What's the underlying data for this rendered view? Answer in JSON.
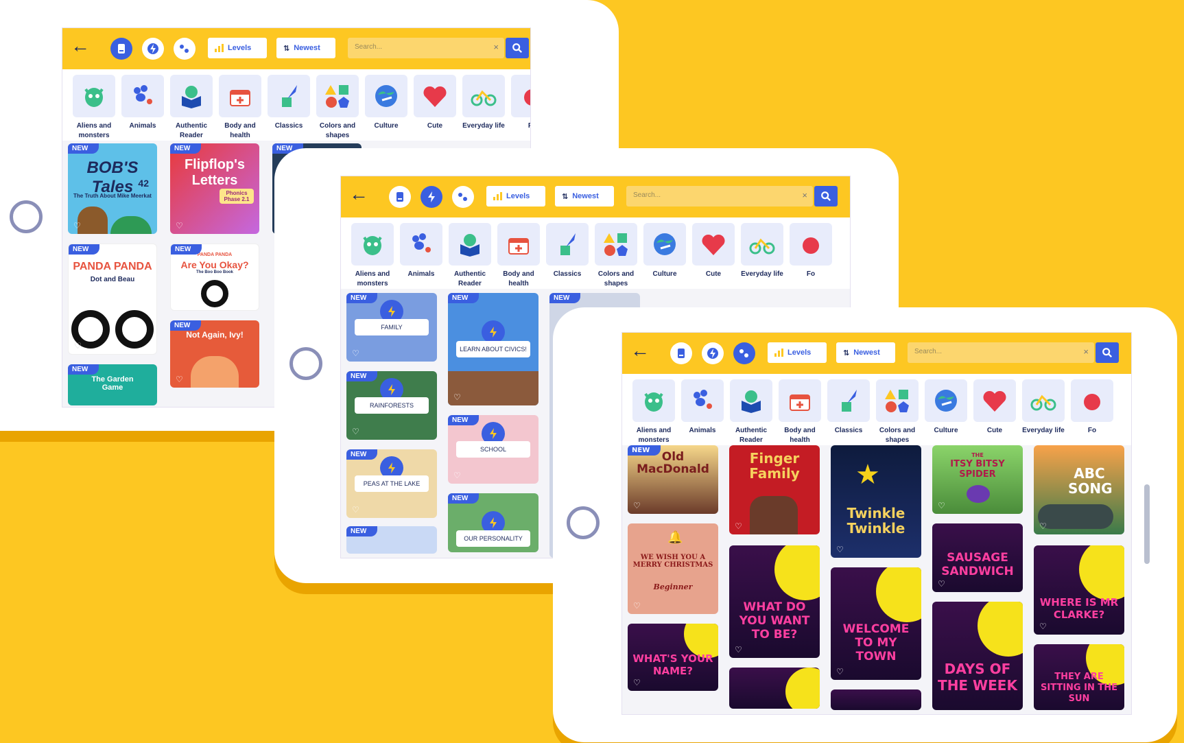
{
  "toolbar": {
    "levels_label": "Levels",
    "sort_label": "Newest",
    "search_placeholder": "Search...",
    "search_clear": "×"
  },
  "categories": [
    {
      "label": "Aliens and monsters",
      "icon": "alien-icon"
    },
    {
      "label": "Animals",
      "icon": "paw-icon"
    },
    {
      "label": "Authentic Reader",
      "icon": "book-icon"
    },
    {
      "label": "Body and health",
      "icon": "first-aid-icon"
    },
    {
      "label": "Classics",
      "icon": "quill-icon"
    },
    {
      "label": "Colors and shapes",
      "icon": "shapes-icon"
    },
    {
      "label": "Culture",
      "icon": "globe-icon"
    },
    {
      "label": "Cute",
      "icon": "heart-icon"
    },
    {
      "label": "Everyday life",
      "icon": "bicycle-icon"
    },
    {
      "label": "Fo",
      "icon": "food-icon"
    }
  ],
  "badge_new": "NEW",
  "screen1": {
    "books": [
      {
        "title": "BOB'S Tales",
        "sub": "The Truth About Mike Meerkat",
        "num": "42",
        "bg": "#5EC0E8"
      },
      {
        "title": "Flipflop's Letters",
        "sub": "Phonics Phase 2.1",
        "bg": "#E83A3A"
      },
      {
        "title": "PANDA PANDA",
        "sub": "Dot and Beau",
        "bg": "#ffffff"
      },
      {
        "title": "Are You Okay?",
        "sub": "The Boo Boo Book",
        "top": "PANDA PANDA",
        "bg": "#ffffff"
      },
      {
        "title": "Not Again, Ivy!",
        "bg": "#E65B3A"
      },
      {
        "title": "The Garden Game",
        "bg": "#1FAE9C"
      }
    ]
  },
  "screen2": {
    "topics": [
      {
        "label": "FAMILY"
      },
      {
        "label": "LEARN ABOUT CIVICS!"
      },
      {
        "label": "RAINFORESTS"
      },
      {
        "label": "SCHOOL"
      },
      {
        "label": "PEAS AT THE LAKE"
      },
      {
        "label": "OUR PERSONALITY"
      }
    ]
  },
  "screen3": {
    "songs": [
      {
        "title": "Old MacDonald"
      },
      {
        "title": "Finger Family"
      },
      {
        "title": "Twinkle Twinkle"
      },
      {
        "title": "ITSY BITSY SPIDER",
        "top": "THE"
      },
      {
        "title": "ABC SONG"
      },
      {
        "title": "WE WISH YOU A MERRY CHRISTMAS",
        "sub": "Beginner"
      },
      {
        "title": "WHAT DO YOU WANT TO BE?"
      },
      {
        "title": "WELCOME TO MY TOWN"
      },
      {
        "title": "SAUSAGE SANDWICH"
      },
      {
        "title": "WHERE IS MR CLARKE?"
      },
      {
        "title": "WHAT'S YOUR NAME?"
      },
      {
        "title": "DAYS OF THE WEEK"
      },
      {
        "title": "THEY ARE SITTING IN THE SUN"
      }
    ]
  }
}
